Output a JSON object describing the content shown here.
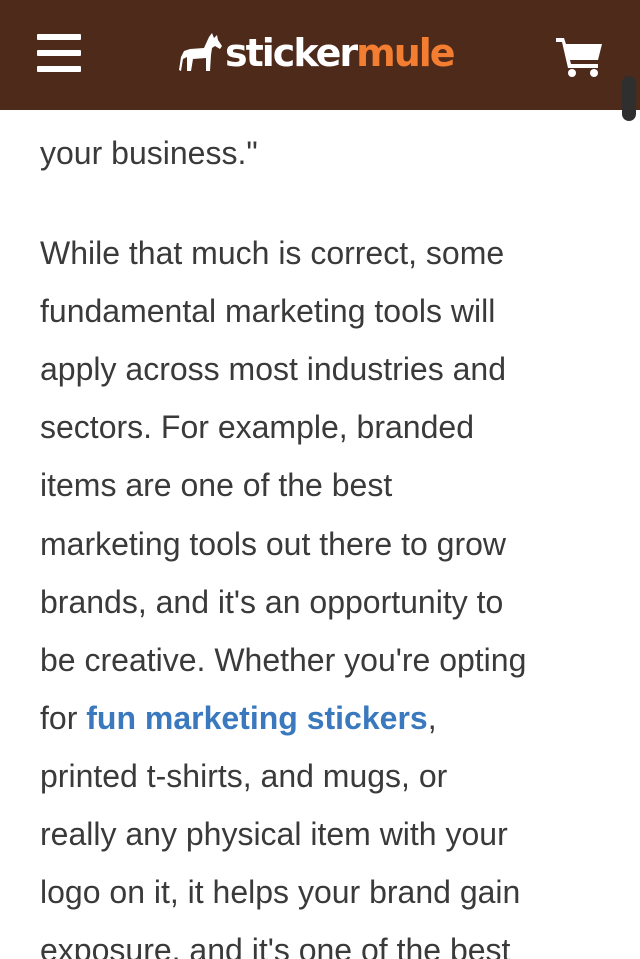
{
  "header": {
    "logo_sticker": "sticker",
    "logo_mule": "mule",
    "brand_colors": {
      "bar": "#4e2a1a",
      "logo_accent": "#f37d31",
      "link": "#3a79bd"
    },
    "icons": [
      "menu-icon",
      "mule-logo-icon",
      "cart-icon"
    ]
  },
  "article": {
    "lines": [
      "your business.\"",
      "While that much is correct, some",
      "fundamental marketing tools will",
      "apply across most industries and",
      "sectors. For example, branded",
      "items are one of the best",
      "marketing tools out there to grow",
      "brands, and it's an opportunity to",
      "be creative. Whether you're opting"
    ],
    "link_line_prefix": "for ",
    "link_text": "fun marketing stickers",
    "link_line_suffix": ",",
    "lines_after": [
      "printed t-shirts, and mugs, or",
      "really any physical item with your",
      "logo on it, it helps your brand gain",
      "exposure, and it's one of the best"
    ]
  }
}
